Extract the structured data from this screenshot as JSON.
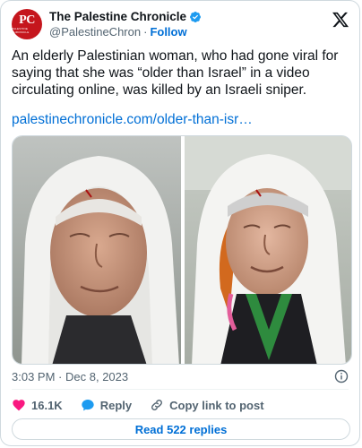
{
  "author": {
    "name": "The Palestine Chronicle",
    "handle": "@PalestineChron",
    "follow_label": "Follow",
    "avatar_initials": "PC",
    "avatar_brand": "PALESTINE CHRONICLE",
    "verified_color": "#1d9bf0",
    "avatar_color": "#c5161d"
  },
  "platform_icon": "x-logo-icon",
  "tweet": {
    "text": "An elderly Palestinian woman, who had gone viral for saying that she was “older than Israel” in a video circulating online, was killed by an Israeli sniper.",
    "link": "palestinechronicle.com/older-than-isr…"
  },
  "media": {
    "count": 2,
    "description_icons": [
      "photo-elderly-woman-left",
      "photo-elderly-woman-right"
    ]
  },
  "timestamp": {
    "time": "3:03 PM",
    "separator": "·",
    "date": "Dec 8, 2023"
  },
  "actions": {
    "likes_count": "16.1K",
    "reply_label": "Reply",
    "copy_label": "Copy link to post",
    "like_color": "#f91880",
    "reply_color": "#1d9bf0"
  },
  "read_replies_label": "Read 522 replies",
  "accent_color": "#006fd6"
}
